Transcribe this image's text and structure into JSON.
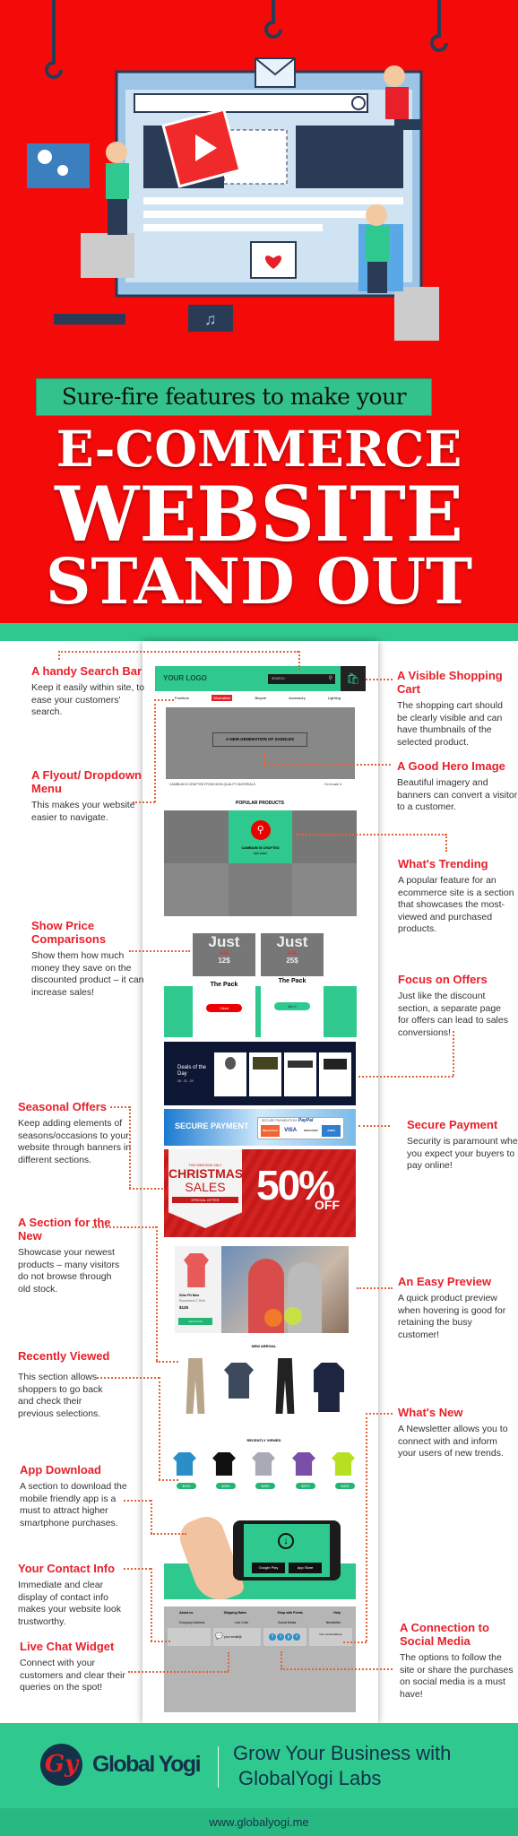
{
  "colors": {
    "red": "#f50a0a",
    "teal": "#2fc98f",
    "annotation_red": "#e8202a",
    "navy": "#13324a"
  },
  "header": {
    "subtitle": "Sure-fire features to make your",
    "line1": "E-COMMERCE",
    "line2": "WEBSITE",
    "line3": "STAND OUT"
  },
  "annotations_left": [
    {
      "title": "A handy Search Bar",
      "desc": "Keep it easily within site, to ease your customers' search."
    },
    {
      "title": "A Flyout/ Dropdown Menu",
      "desc": "This makes your website easier to navigate."
    },
    {
      "title": "Show Price Comparisons",
      "desc": "Show them how much money they save on the discounted product – it can increase sales!"
    },
    {
      "title": "Seasonal Offers",
      "desc": "Keep adding elements of seasons/occasions to your website through banners in different sections."
    },
    {
      "title": "A Section for the New",
      "desc": "Showcase your newest products – many visitors do not browse through old stock."
    },
    {
      "title": "Recently Viewed",
      "desc": "This section allows shoppers to go back and check their previous selections."
    },
    {
      "title": "App Download",
      "desc": "A section to download the mobile friendly app is a must to attract higher smartphone purchases."
    },
    {
      "title": "Your Contact Info",
      "desc": "Immediate and clear display of contact info makes your website look trustworthy."
    },
    {
      "title": "Live Chat Widget",
      "desc": "Connect with your customers and clear their queries on the spot!"
    }
  ],
  "annotations_right": [
    {
      "title": "A Visible Shopping Cart",
      "desc": "The shopping cart should be clearly visible and can have thumbnails of the selected product."
    },
    {
      "title": "A Good Hero Image",
      "desc": "Beautiful imagery and banners can convert a visitor to a customer."
    },
    {
      "title": "What's Trending",
      "desc": "A popular feature for an ecommerce site is a section that showcases the most-viewed and purchased products."
    },
    {
      "title": "Focus on Offers",
      "desc": "Just like the discount section, a separate page for offers can lead to sales conversions!"
    },
    {
      "title": "Secure Payment",
      "desc": "Security is paramount when you expect your buyers to pay online!"
    },
    {
      "title": "An Easy Preview",
      "desc": "A quick product preview when hovering is good for retaining the busy customer!"
    },
    {
      "title": "What's New",
      "desc": "A Newsletter allows you to connect with and inform your users of new trends."
    },
    {
      "title": "A Connection to Social Media",
      "desc": "The options to follow the site or share the purchases on social media is a must have!"
    }
  ],
  "mockup": {
    "logo": "YOUR LOGO",
    "search_placeholder": "SEARCH",
    "nav": [
      "Furniture",
      "Wearables",
      "Bicycle",
      "Accessory",
      "Lighting"
    ],
    "hero_button": "A NEW GENERATION OF SADDLES",
    "hero_caption": "CAMBIUM IS CRAFTED FROM HIGH-QUALITY MATERIALS",
    "hero_link": "Go to sale it",
    "popular_title": "POPULAR PRODUCTS",
    "popular_card_title": "CAMBIUM IS CRAFTED",
    "popular_card_link": "look closer",
    "offers": [
      {
        "just": "Just",
        "old": "30$",
        "new": "12$",
        "name": "The Pack",
        "button": "I liked"
      },
      {
        "just": "Just",
        "old": "30$",
        "new": "25$",
        "name": "The Pack",
        "button": "like it"
      }
    ],
    "deals_title": "Deals of the Day",
    "deals_timer": "08 : 32 : 29",
    "secure_title": "SECURE PAYMENT",
    "secure_by": "SECURE PAYMENTS BY",
    "paypal": "PayPal",
    "cards": [
      "MasterCard",
      "VISA",
      "DISCOVER",
      "AMEX"
    ],
    "xmas": {
      "tag": "THIS WEEKEND ONLY",
      "line1": "CHRISTMAS",
      "line2": "SALES",
      "ribbon": "SPECIAL OFFER",
      "pct": "50%",
      "off": "OFF"
    },
    "preview": {
      "name": "Slim Fit Men",
      "sub": "Roundneck T-Shirt",
      "price": "$125",
      "button": "Add To Cart"
    },
    "new_arrival": "NEW ARRIVAL",
    "recently_viewed": "RECENTLY VIEWED",
    "recent_prices": [
      "$120",
      "$340",
      "$250",
      "$370",
      "$425"
    ],
    "app_badges": [
      "Google Play",
      "App Store"
    ],
    "footer_links": [
      "About us",
      "Shipping Rates",
      "Shop with Points",
      "Help"
    ],
    "footer_cols": [
      "Company Address",
      "Live Chat",
      "Social Media",
      "Newsletter"
    ],
    "chat_placeholder": "your email@",
    "newsletter_placeholder": "Your email Address"
  },
  "footer": {
    "brand": "Global Yogi",
    "logo_letters": "Gy",
    "tagline1": "Grow Your Business with",
    "tagline2": "GlobalYogi Labs",
    "url": "www.globalyogi.me"
  }
}
